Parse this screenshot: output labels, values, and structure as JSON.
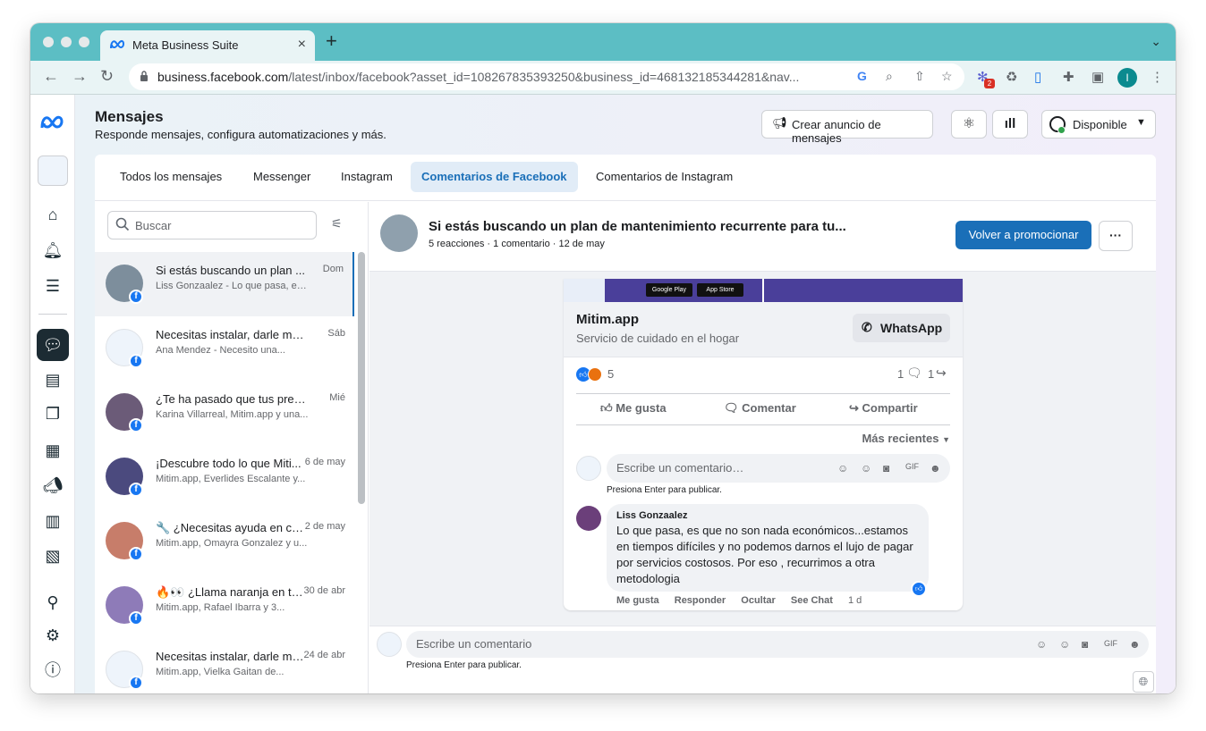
{
  "browser": {
    "tab_title": "Meta Business Suite",
    "url_host": "business.facebook.com",
    "url_path": "/latest/inbox/facebook?asset_id=108267835393250&business_id=468132185344281&nav...",
    "extension_badge": "2",
    "profile_initial": "I"
  },
  "header": {
    "title": "Mensajes",
    "subtitle": "Responde mensajes, configura automatizaciones y más.",
    "create_ad_label": "Crear anuncio de mensajes",
    "status_label": "Disponible"
  },
  "tabs": [
    {
      "label": "Todos los mensajes"
    },
    {
      "label": "Messenger"
    },
    {
      "label": "Instagram"
    },
    {
      "label": "Comentarios de Facebook"
    },
    {
      "label": "Comentarios de Instagram"
    }
  ],
  "search": {
    "placeholder": "Buscar"
  },
  "conversations": [
    {
      "title": "Si estás buscando un plan ...",
      "snippet": "Liss Gonzaalez - Lo que pasa, es...",
      "date": "Dom"
    },
    {
      "title": "Necesitas instalar, darle ma...",
      "snippet": "Ana Mendez - Necesito una...",
      "date": "Sáb"
    },
    {
      "title": "¿Te ha pasado que tus pren...",
      "snippet": "Karina Villarreal, Mitim.app y una...",
      "date": "Mié"
    },
    {
      "title": "¡Descubre todo lo que Miti...",
      "snippet": "Mitim.app, Everlides Escalante y...",
      "date": "6 de may"
    },
    {
      "title": "🔧 ¿Necesitas ayuda en ca...",
      "snippet": "Mitim.app, Omayra Gonzalez y u...",
      "date": "2 de may"
    },
    {
      "title": "🔥👀 ¿Llama naranja en tu ...",
      "snippet": "Mitim.app, Rafael Ibarra y 3...",
      "date": "30 de abr"
    },
    {
      "title": "Necesitas instalar, darle ma...",
      "snippet": "Mitim.app, Vielka Gaitan de...",
      "date": "24 de abr"
    }
  ],
  "post": {
    "title": "Si estás buscando un plan de mantenimiento recurrente para tu...",
    "meta": "5 reacciones · 1 comentario · 12 de may",
    "promote_label": "Volver a promocionar",
    "more_label": "···",
    "banner_google": "Google Play",
    "banner_apple": "App Store",
    "link_title": "Mitim.app",
    "link_subtitle": "Servicio de cuidado en el hogar",
    "whatsapp_label": "WhatsApp",
    "reaction_count": "5",
    "comment_count": "1",
    "share_count": "1",
    "like_label": "Me gusta",
    "comment_label": "Comentar",
    "share_label": "Compartir",
    "sort_label": "Más recientes",
    "comment_placeholder": "Escribe un comentario…",
    "enter_hint": "Presiona Enter para publicar."
  },
  "comment": {
    "author": "Liss Gonzaalez",
    "text": "Lo que pasa, es que no son nada económicos...estamos en tiempos difíciles y no podemos darnos el lujo de pagar por servicios costosos. Por eso , recurrimos a otra metodologia",
    "like": "Me gusta",
    "reply": "Responder",
    "hide": "Ocultar",
    "see_chat": "See Chat",
    "age": "1 d"
  },
  "composer": {
    "placeholder": "Escribe un comentario",
    "hint": "Presiona Enter para publicar."
  },
  "colors": {
    "accent": "#1a6fb8",
    "facebook": "#1877f2",
    "tabstrip": "#5cbec4",
    "banner": "#4a3f9a"
  }
}
